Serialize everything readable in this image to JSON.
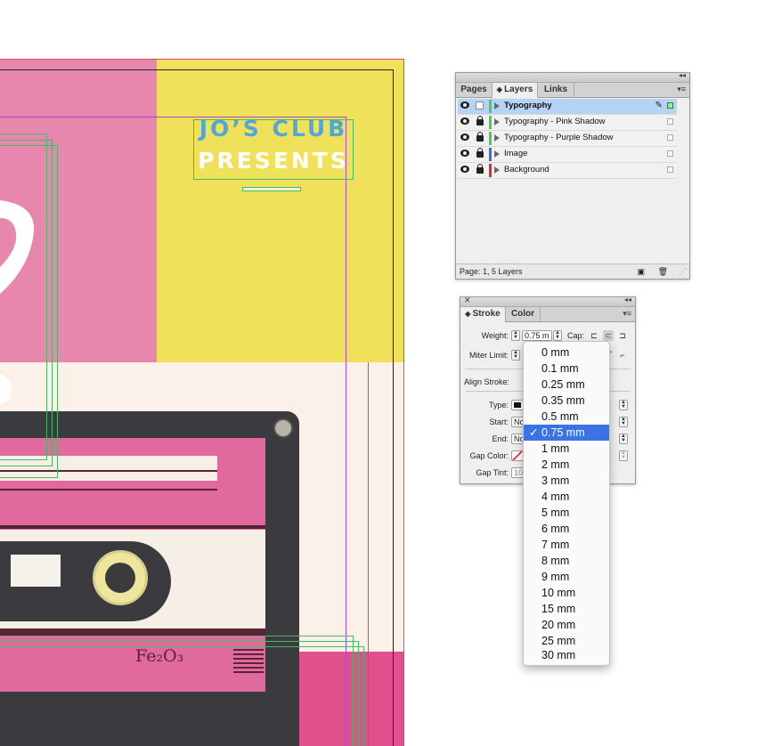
{
  "poster": {
    "line1": "JO’S CLUB",
    "line2": "PRESENTS",
    "cassette_label": "Fe₂O₃"
  },
  "colors": {
    "pink": "#e887ae",
    "yellow": "#efe25a",
    "cream": "#fbf1e8",
    "hot_pink": "#e0508c",
    "cassette_dark": "#3b3a3f",
    "title_blue": "#4fa7dc",
    "title_white": "#ffffff",
    "selection_blue": "#3b73e6"
  },
  "layers_panel": {
    "tabs": [
      "Pages",
      "Layers",
      "Links"
    ],
    "active_tab": "Layers",
    "layers": [
      {
        "name": "Typography",
        "color": "#4ccf4c",
        "selected": true,
        "locked": false
      },
      {
        "name": "Typography - Pink Shadow",
        "color": "#4ccf4c",
        "selected": false,
        "locked": true
      },
      {
        "name": "Typography - Purple Shadow",
        "color": "#4ccf4c",
        "selected": false,
        "locked": true
      },
      {
        "name": "Image",
        "color": "#3b70d8",
        "selected": false,
        "locked": true
      },
      {
        "name": "Background",
        "color": "#d83030",
        "selected": false,
        "locked": true
      }
    ],
    "footer": "Page: 1, 5 Layers"
  },
  "stroke_panel": {
    "tabs": [
      "Stroke",
      "Color"
    ],
    "active_tab": "Stroke",
    "weight_label": "Weight:",
    "weight_value": "0.75 m",
    "cap_label": "Cap:",
    "miter_label": "Miter Limit:",
    "align_label": "Align Stroke:",
    "type_label": "Type:",
    "start_label": "Start:",
    "start_value": "No",
    "end_label": "End:",
    "end_value": "No",
    "gap_color_label": "Gap Color:",
    "gap_tint_label": "Gap Tint:",
    "gap_tint_value": "100"
  },
  "weight_dropdown": {
    "selected": "0.75 mm",
    "options": [
      "0 mm",
      "0.1 mm",
      "0.25 mm",
      "0.35 mm",
      "0.5 mm",
      "0.75 mm",
      "1 mm",
      "2 mm",
      "3 mm",
      "4 mm",
      "5 mm",
      "6 mm",
      "7 mm",
      "8 mm",
      "9 mm",
      "10 mm",
      "15 mm",
      "20 mm",
      "25 mm",
      "30 mm"
    ]
  },
  "icons": {
    "close": "close-icon",
    "collapse": "collapse-icon",
    "menu": "panel-menu-icon",
    "visibility": "eye-icon",
    "lock": "lock-icon",
    "pen": "pen-icon",
    "new_layer": "new-layer-icon",
    "trash": "trash-icon",
    "checkmark": "checkmark-icon"
  }
}
